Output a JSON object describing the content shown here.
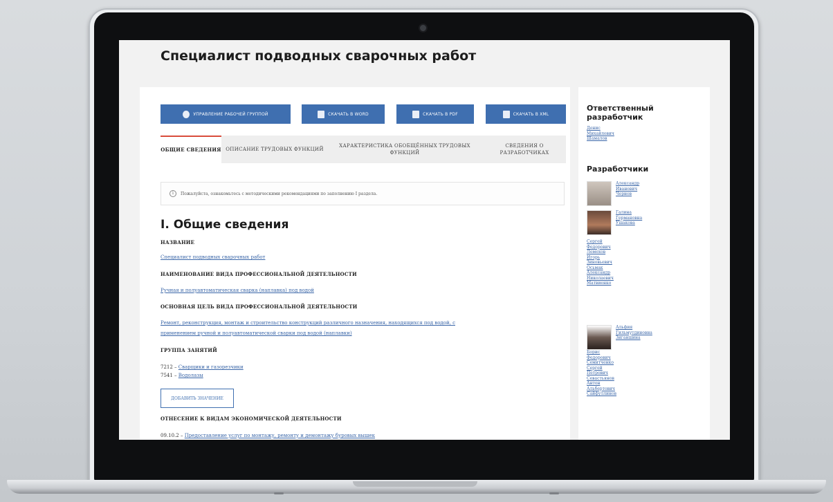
{
  "page": {
    "title": "Специалист подводных сварочных работ"
  },
  "toolbar": {
    "buttons": [
      {
        "label": "УПРАВЛЕНИЕ РАБОЧЕЙ ГРУППОЙ",
        "icon": "gear-icon"
      },
      {
        "label": "СКАЧАТЬ В WORD",
        "icon": "word-icon"
      },
      {
        "label": "СКАЧАТЬ В PDF",
        "icon": "pdf-icon"
      },
      {
        "label": "СКАЧАТЬ В XML",
        "icon": "xml-icon"
      }
    ]
  },
  "tabs": [
    {
      "label": "ОБЩИЕ СВЕДЕНИЯ",
      "active": true
    },
    {
      "label": "ОПИСАНИЕ ТРУДОВЫХ ФУНКЦИЙ"
    },
    {
      "label": "ХАРАКТЕРИСТИКА ОБОБЩЁННЫХ ТРУДОВЫХ ФУНКЦИЙ"
    },
    {
      "label": "СВЕДЕНИЯ О РАЗРАБОТЧИКАХ"
    }
  ],
  "notice": "Пожалуйста, ознакомьтесь с методическими рекомендациями по заполнению I раздела.",
  "section": {
    "heading": "I. Общие сведения",
    "name_label": "НАЗВАНИЕ",
    "name_value": "Специалист подводных сварочных работ",
    "activity_label": "НАИМЕНОВАНИЕ ВИДА ПРОФЕССИОНАЛЬНОЙ ДЕЯТЕЛЬНОСТИ",
    "activity_value": "Ручная и полуавтоматическая сварка (наплавка) под водой",
    "goal_label": "ОСНОВНАЯ ЦЕЛЬ ВИДА ПРОФЕССИОНАЛЬНОЙ ДЕЯТЕЛЬНОСТИ",
    "goal_value_1": "Ремонт, реконструкция, монтаж и строительство конструкций различного назначения, находящихся под водой, с",
    "goal_value_2": "применением ручной и полуавтоматической сварки под водой (наплавки)",
    "group_label": "ГРУППА ЗАНЯТИЙ",
    "groups": [
      {
        "code": "7212 –",
        "name": "Сварщики и газорезчики"
      },
      {
        "code": "7541 –",
        "name": "Водолазы"
      }
    ],
    "add_button": "ДОБАВИТЬ ЗНАЧЕНИЕ",
    "okved_label": "ОТНЕСЕНИЕ К ВИДАМ ЭКОНОМИЧЕСКОЙ ДЕЯТЕЛЬНОСТИ",
    "okved_code": "09.10.2 –",
    "okved_name": "Предоставление услуг по монтажу, ремонту и демонтажу буровых вышек"
  },
  "sidebar": {
    "responsible_heading": "Ответственный разработчик",
    "responsible": [
      "Денис",
      "Михайлович",
      "Шамалов"
    ],
    "developers_heading": "Разработчики",
    "dev1": [
      "Александр",
      "Иванович",
      "Чернов"
    ],
    "dev2": [
      "Галина",
      "Германовна",
      "Ушакова"
    ],
    "plain_devs": [
      "Сергей",
      "Федорович",
      "Лемехов",
      "Игорь",
      "Зиновьевич",
      "Осьмак",
      "Александр",
      "Николаевич",
      "Матвиенко"
    ],
    "dev3": [
      "Альфия",
      "Гильмутдиновна",
      "Зиганшина"
    ],
    "more_devs": [
      "Борис",
      "Федорович",
      "Семитченко",
      "Сергей",
      "Петрович",
      "Севастьянов",
      "Антон",
      "Альбертович",
      "Сайфуллинов"
    ]
  }
}
